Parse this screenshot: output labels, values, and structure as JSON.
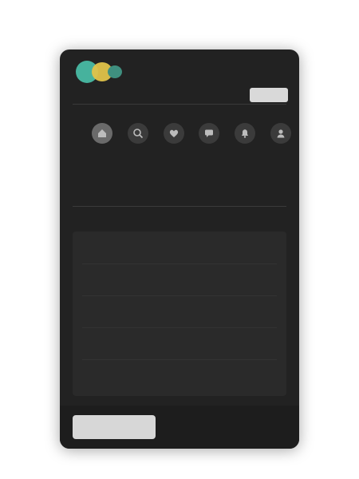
{
  "app": {
    "logo_text": "",
    "menu_label": ""
  },
  "header": {
    "subtitle": ""
  },
  "toolbar": {
    "icons": [
      {
        "name": "home-icon"
      },
      {
        "name": "search-icon"
      },
      {
        "name": "heart-icon"
      },
      {
        "name": "chat-icon"
      },
      {
        "name": "bell-icon"
      },
      {
        "name": "user-icon"
      }
    ]
  },
  "stats": [
    {
      "value": "",
      "label": ""
    },
    {
      "value": "",
      "label": ""
    },
    {
      "value": "",
      "label": ""
    }
  ],
  "section": {
    "title": ""
  },
  "panel": {
    "text": "",
    "foot": ""
  },
  "footer": {
    "store_badge": "",
    "links": [
      "",
      "",
      ""
    ],
    "note": ""
  },
  "colors": {
    "background": "#222222",
    "accent_teal": "#46b29d",
    "accent_yellow": "#e0c34a"
  }
}
